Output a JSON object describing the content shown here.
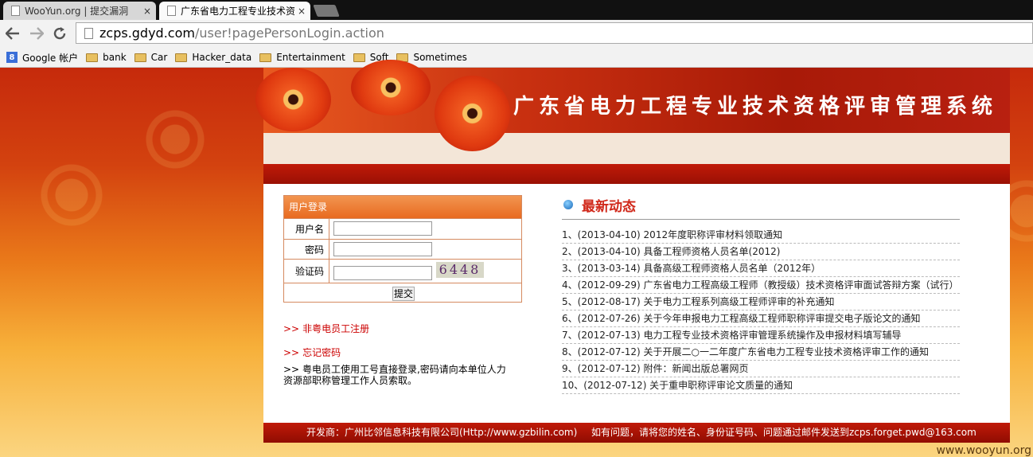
{
  "browser": {
    "tabs": [
      {
        "title": "WooYun.org | 提交漏洞",
        "close": "×"
      },
      {
        "title": "广东省电力工程专业技术资",
        "close": "×"
      }
    ],
    "url_host": "zcps.gdyd.com",
    "url_path": "/user!pagePersonLogin.action",
    "bookmarks": [
      "Google 帐户",
      "bank",
      "Car",
      "Hacker_data",
      "Entertainment",
      "Soft",
      "Sometimes"
    ],
    "google_icon_letter": "8"
  },
  "header": {
    "title": "广东省电力工程专业技术资格评审管理系统"
  },
  "login": {
    "heading": "用户登录",
    "username_label": "用户名",
    "password_label": "密码",
    "captcha_label": "验证码",
    "captcha_text": "6448",
    "submit_label": "提交"
  },
  "links": {
    "register": "非粤电员工注册",
    "forgot": "忘记密码",
    "arrow": ">>",
    "note_prefix": ">>",
    "note": "粤电员工使用工号直接登录,密码请向本单位人力资源部职称管理工作人员索取。"
  },
  "news": {
    "title": "最新动态",
    "items": [
      "1、(2013-04-10)  2012年度职称评审材料领取通知",
      "2、(2013-04-10)  具备工程师资格人员名单(2012)",
      "3、(2013-03-14)  具备高级工程师资格人员名单（2012年）",
      "4、(2012-09-29)  广东省电力工程高级工程师（教授级）技术资格评审面试答辩方案（试行）",
      "5、(2012-08-17)  关于电力工程系列高级工程师评审的补充通知",
      "6、(2012-07-26)  关于今年申报电力工程高级工程师职称评审提交电子版论文的通知",
      "7、(2012-07-13)  电力工程专业技术资格评审管理系统操作及申报材料填写辅导",
      "8、(2012-07-12)  关于开展二○一二年度广东省电力工程专业技术资格评审工作的通知",
      "9、(2012-07-12)  附件：新闻出版总署网页",
      "10、(2012-07-12)  关于重申职称评审论文质量的通知"
    ]
  },
  "footer": {
    "developer": "开发商：广州比邻信息科技有限公司(Http://www.gzbilin.com)",
    "contact": "如有问题，请将您的姓名、身份证号码、问题通过邮件发送到zcps.forget.pwd@163.com"
  },
  "watermark": "www.wooyun.org"
}
